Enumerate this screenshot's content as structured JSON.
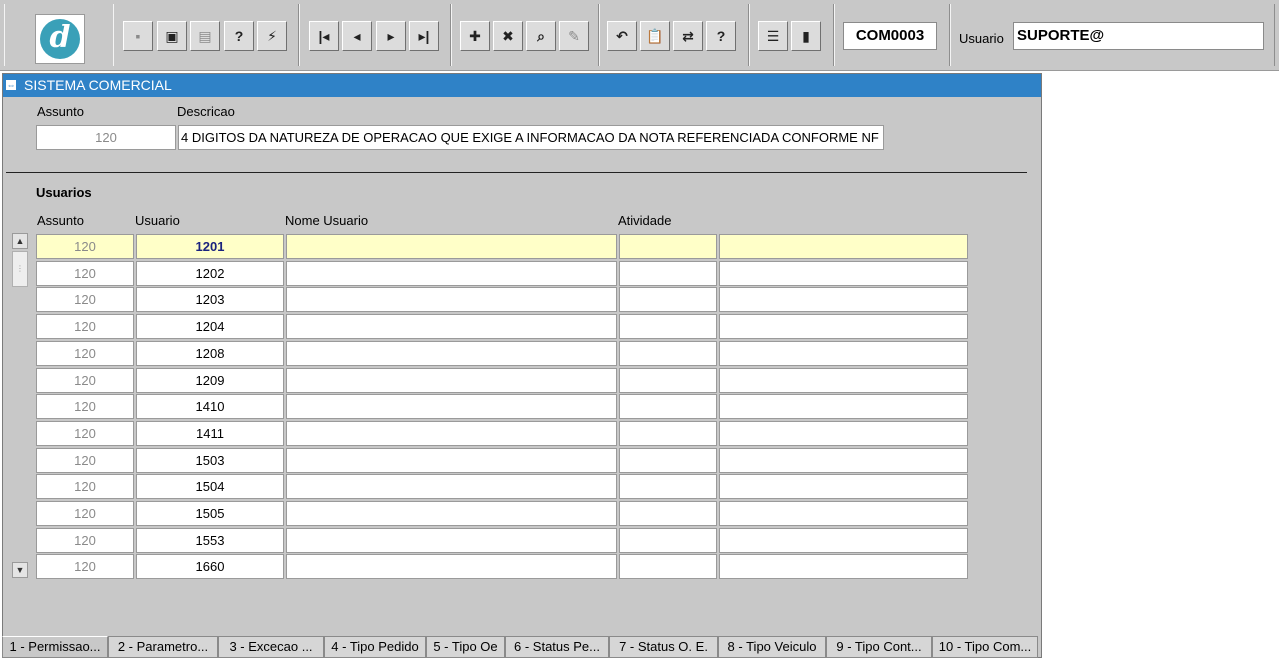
{
  "toolbar": {
    "logo_letter": "d",
    "buttons": [
      {
        "icon": "save-icon",
        "glyph": "▪"
      },
      {
        "icon": "window-icon",
        "glyph": "▣"
      },
      {
        "icon": "print-icon",
        "glyph": "▤"
      },
      {
        "icon": "help-query-icon",
        "glyph": "?"
      },
      {
        "icon": "execute-query-icon",
        "glyph": "⚡"
      },
      {
        "icon": "first-record-icon",
        "glyph": "|◂"
      },
      {
        "icon": "previous-record-icon",
        "glyph": "◂"
      },
      {
        "icon": "next-record-icon",
        "glyph": "▸"
      },
      {
        "icon": "last-record-icon",
        "glyph": "▸|"
      },
      {
        "icon": "insert-record-icon",
        "glyph": "✚"
      },
      {
        "icon": "delete-record-icon",
        "glyph": "✖"
      },
      {
        "icon": "query-icon",
        "glyph": "⌕"
      },
      {
        "icon": "clear-icon",
        "glyph": "✎"
      },
      {
        "icon": "undo-icon",
        "glyph": "↶"
      },
      {
        "icon": "clipboard-icon",
        "glyph": "📋"
      },
      {
        "icon": "switch-icon",
        "glyph": "⇄"
      },
      {
        "icon": "help-icon",
        "glyph": "?"
      },
      {
        "icon": "menu-icon",
        "glyph": "☰"
      },
      {
        "icon": "exit-icon",
        "glyph": "▮"
      }
    ],
    "form_code": "COM0003",
    "user_label": "Usuario",
    "user_value": "SUPORTE@"
  },
  "window": {
    "title": "SISTEMA COMERCIAL",
    "header": {
      "assunto_label": "Assunto",
      "descricao_label": "Descricao",
      "assunto_value": "120",
      "descricao_value": "4 DIGITOS DA NATUREZA DE OPERACAO QUE EXIGE A INFORMACAO DA NOTA REFERENCIADA CONFORME NF"
    },
    "section_title": "Usuarios",
    "columns": {
      "assunto": "Assunto",
      "usuario": "Usuario",
      "nome": "Nome Usuario",
      "atividade": "Atividade"
    },
    "rows": [
      {
        "assunto": "120",
        "usuario": "1201",
        "nome": "",
        "atividade": "",
        "extra": ""
      },
      {
        "assunto": "120",
        "usuario": "1202",
        "nome": "",
        "atividade": "",
        "extra": ""
      },
      {
        "assunto": "120",
        "usuario": "1203",
        "nome": "",
        "atividade": "",
        "extra": ""
      },
      {
        "assunto": "120",
        "usuario": "1204",
        "nome": "",
        "atividade": "",
        "extra": ""
      },
      {
        "assunto": "120",
        "usuario": "1208",
        "nome": "",
        "atividade": "",
        "extra": ""
      },
      {
        "assunto": "120",
        "usuario": "1209",
        "nome": "",
        "atividade": "",
        "extra": ""
      },
      {
        "assunto": "120",
        "usuario": "1410",
        "nome": "",
        "atividade": "",
        "extra": ""
      },
      {
        "assunto": "120",
        "usuario": "1411",
        "nome": "",
        "atividade": "",
        "extra": ""
      },
      {
        "assunto": "120",
        "usuario": "1503",
        "nome": "",
        "atividade": "",
        "extra": ""
      },
      {
        "assunto": "120",
        "usuario": "1504",
        "nome": "",
        "atividade": "",
        "extra": ""
      },
      {
        "assunto": "120",
        "usuario": "1505",
        "nome": "",
        "atividade": "",
        "extra": ""
      },
      {
        "assunto": "120",
        "usuario": "1553",
        "nome": "",
        "atividade": "",
        "extra": ""
      },
      {
        "assunto": "120",
        "usuario": "1660",
        "nome": "",
        "atividade": "",
        "extra": ""
      }
    ],
    "selected_row": 0
  },
  "tabs": [
    {
      "label": "1 - Permissao..."
    },
    {
      "label": "2 - Parametro..."
    },
    {
      "label": "3 - Excecao ..."
    },
    {
      "label": "4 - Tipo Pedido"
    },
    {
      "label": "5 - Tipo Oe"
    },
    {
      "label": "6 - Status Pe..."
    },
    {
      "label": "7 - Status O. E."
    },
    {
      "label": "8 - Tipo Veiculo"
    },
    {
      "label": "9 - Tipo Cont..."
    },
    {
      "label": "10 - Tipo Com..."
    }
  ],
  "active_tab": 0
}
